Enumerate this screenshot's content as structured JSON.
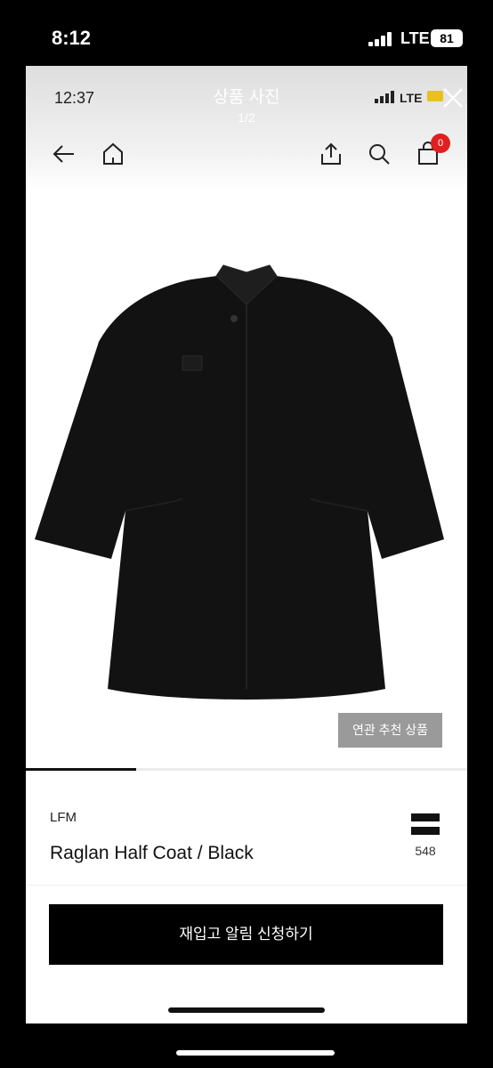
{
  "outer_status": {
    "time": "8:12",
    "network": "LTE",
    "battery": "81"
  },
  "inner_status": {
    "time": "12:37",
    "network": "LTE"
  },
  "header": {
    "title": "상품 사진",
    "page_indicator": "1/2"
  },
  "nav": {
    "icons": [
      "back-arrow-icon",
      "home-icon",
      "share-icon",
      "search-icon",
      "shopping-bag-icon",
      "close-icon"
    ],
    "cart_badge": "0"
  },
  "gallery": {
    "related_button": "연관 추천 상품",
    "progress_fraction": 0.25
  },
  "product": {
    "brand": "LFM",
    "name": "Raglan Half Coat / Black",
    "like_count": "548"
  },
  "cta": {
    "label": "재입고 알림 신청하기"
  }
}
